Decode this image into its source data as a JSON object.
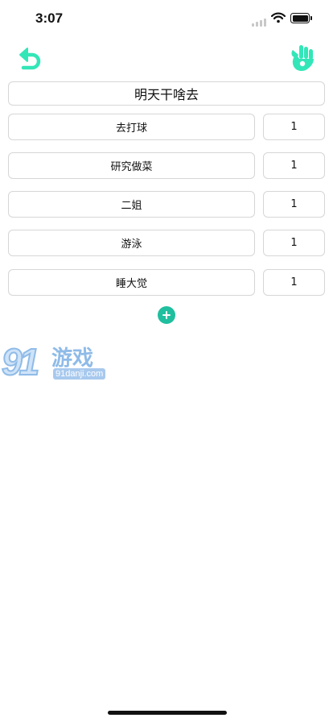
{
  "status_bar": {
    "time": "3:07"
  },
  "header": {
    "back_icon": "undo-arrow-icon",
    "confirm_icon": "ok-hand-icon",
    "accent_color": "#33e6b8"
  },
  "title": "明天干啥去",
  "options": [
    {
      "name": "去打球",
      "weight": "1"
    },
    {
      "name": "研究做菜",
      "weight": "1"
    },
    {
      "name": "二姐",
      "weight": "1"
    },
    {
      "name": "游泳",
      "weight": "1"
    },
    {
      "name": "睡大觉",
      "weight": "1"
    }
  ],
  "add_button": {
    "icon": "plus-icon",
    "color": "#1fbf9f"
  },
  "watermark": {
    "number": "91",
    "name": "游戏",
    "url": "91danji.com"
  }
}
